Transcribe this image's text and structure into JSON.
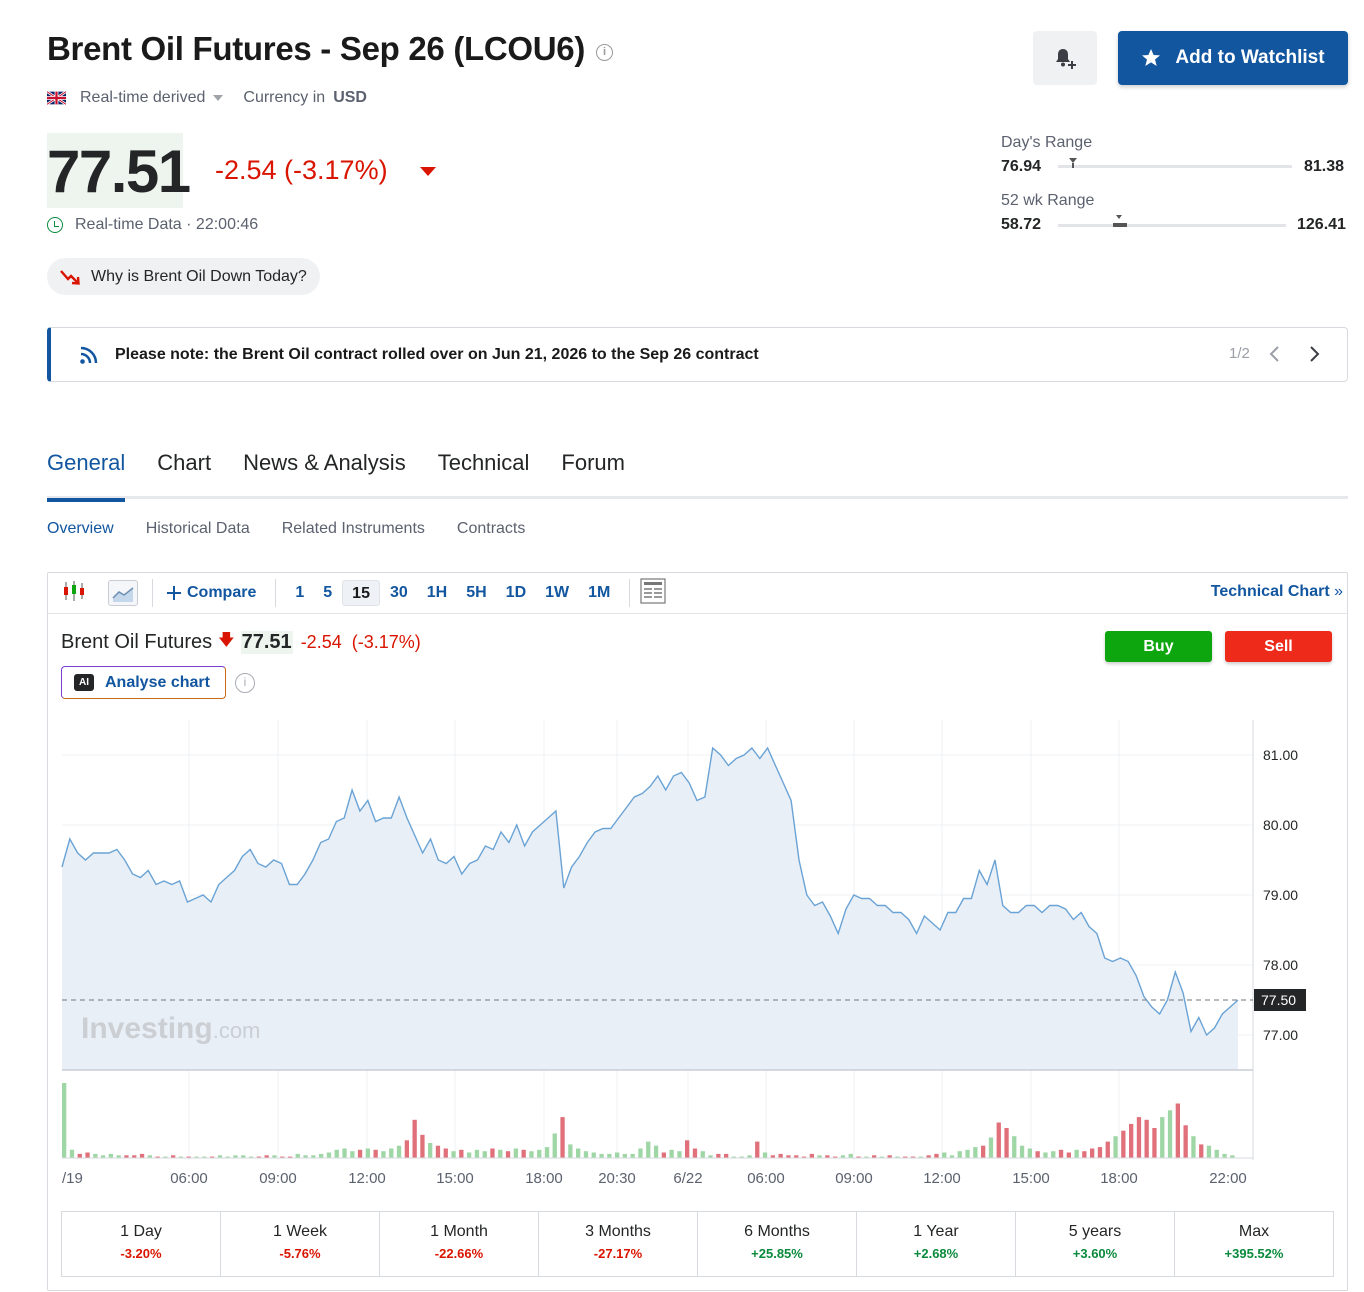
{
  "header": {
    "title": "Brent Oil Futures - Sep 26 (LCOU6)",
    "source": "Real-time derived",
    "currency_label": "Currency in",
    "currency": "USD",
    "watchlist_label": "Add to Watchlist"
  },
  "quote": {
    "price": "77.51",
    "change": "-2.54 (-3.17%)",
    "realtime_label": "Real-time Data · 22:00:46",
    "why_label": "Why is Brent Oil Down Today?"
  },
  "ranges": {
    "day_label": "Day's Range",
    "day_low": "76.94",
    "day_high": "81.38",
    "day_marker": 0.065,
    "wk52_label": "52 wk Range",
    "wk52_low": "58.72",
    "wk52_high": "126.41",
    "wk52_marker": 0.27
  },
  "notice": {
    "text": "Please note: the Brent Oil contract rolled over on Jun 21, 2026 to the Sep 26 contract",
    "page": "1/2"
  },
  "tabs": [
    "General",
    "Chart",
    "News & Analysis",
    "Technical",
    "Forum"
  ],
  "subtabs": [
    "Overview",
    "Historical Data",
    "Related Instruments",
    "Contracts"
  ],
  "toolbar": {
    "compare": "Compare",
    "intervals": [
      "1",
      "5",
      "15",
      "30",
      "1H",
      "5H",
      "1D",
      "1W",
      "1M"
    ],
    "selected": "15",
    "technical_chart": "Technical Chart"
  },
  "chart_header": {
    "name": "Brent Oil Futures",
    "price": "77.51",
    "change": "-2.54",
    "change_pct": "(-3.17%)",
    "buy": "Buy",
    "sell": "Sell",
    "ai_label": "Analyse chart",
    "ai_badge": "AI"
  },
  "watermark": {
    "brand": "Investing",
    "suffix": ".com"
  },
  "colors": {
    "accent": "#1256a0",
    "negative": "#d91400",
    "positive": "#0a8a3c",
    "line": "#6aa3d5",
    "fill": "#e9eff6"
  },
  "chart_data": {
    "type": "area",
    "ylim": [
      76.5,
      81.5
    ],
    "yticks": [
      "81.00",
      "80.00",
      "79.00",
      "78.00",
      "77.00"
    ],
    "last_price_label": "77.50",
    "last_price": 77.5,
    "xticks": [
      "/19",
      "06:00",
      "09:00",
      "12:00",
      "15:00",
      "18:00",
      "20:30",
      "6/22",
      "06:00",
      "09:00",
      "12:00",
      "15:00",
      "18:00",
      "22:00"
    ],
    "values": [
      79.4,
      79.8,
      79.6,
      79.5,
      79.6,
      79.6,
      79.6,
      79.65,
      79.5,
      79.3,
      79.25,
      79.35,
      79.15,
      79.2,
      79.15,
      79.2,
      78.9,
      78.95,
      79.0,
      78.9,
      79.15,
      79.25,
      79.35,
      79.55,
      79.65,
      79.45,
      79.4,
      79.5,
      79.45,
      79.15,
      79.15,
      79.3,
      79.5,
      79.75,
      79.8,
      80.05,
      80.1,
      80.5,
      80.2,
      80.35,
      80.05,
      80.1,
      80.1,
      80.4,
      80.1,
      79.85,
      79.6,
      79.8,
      79.5,
      79.45,
      79.55,
      79.3,
      79.45,
      79.5,
      79.7,
      79.65,
      79.9,
      79.75,
      80.0,
      79.7,
      79.9,
      80.0,
      80.1,
      80.2,
      79.1,
      79.4,
      79.55,
      79.75,
      79.9,
      79.95,
      79.95,
      80.1,
      80.25,
      80.4,
      80.45,
      80.55,
      80.7,
      80.5,
      80.7,
      80.75,
      80.6,
      80.35,
      80.4,
      81.1,
      81.0,
      80.85,
      80.95,
      81.0,
      81.1,
      80.95,
      81.1,
      80.85,
      80.6,
      80.35,
      79.5,
      79.0,
      78.85,
      78.9,
      78.7,
      78.45,
      78.8,
      79.0,
      78.95,
      78.95,
      78.85,
      78.85,
      78.75,
      78.75,
      78.65,
      78.45,
      78.7,
      78.6,
      78.5,
      78.75,
      78.75,
      78.95,
      78.95,
      79.35,
      79.15,
      79.5,
      78.85,
      78.75,
      78.75,
      78.85,
      78.85,
      78.75,
      78.85,
      78.85,
      78.8,
      78.65,
      78.75,
      78.55,
      78.45,
      78.1,
      78.05,
      78.1,
      78.05,
      77.85,
      77.55,
      77.4,
      77.3,
      77.5,
      77.9,
      77.6,
      77.05,
      77.25,
      77.0,
      77.1,
      77.3,
      77.4,
      77.5
    ],
    "volume": [
      55,
      6,
      3,
      4,
      3,
      2,
      3,
      2,
      2,
      2,
      3,
      2,
      1,
      1,
      2,
      1,
      1,
      1,
      1,
      1,
      2,
      1,
      2,
      2,
      1,
      1,
      2,
      2,
      1,
      1,
      3,
      2,
      2,
      3,
      4,
      6,
      7,
      5,
      6,
      7,
      6,
      5,
      7,
      9,
      13,
      28,
      17,
      11,
      9,
      7,
      5,
      6,
      4,
      6,
      5,
      7,
      6,
      5,
      7,
      6,
      5,
      6,
      8,
      18,
      30,
      10,
      7,
      5,
      4,
      3,
      3,
      4,
      3,
      3,
      7,
      12,
      9,
      4,
      6,
      5,
      13,
      7,
      5,
      2,
      3,
      3,
      1,
      1,
      2,
      12,
      4,
      2,
      3,
      2,
      2,
      1,
      3,
      2,
      2,
      1,
      2,
      3,
      1,
      1,
      2,
      1,
      2,
      1,
      1,
      1,
      1,
      2,
      3,
      4,
      2,
      5,
      6,
      8,
      9,
      15,
      26,
      22,
      16,
      9,
      7,
      5,
      4,
      5,
      6,
      4,
      6,
      5,
      7,
      8,
      12,
      16,
      20,
      25,
      30,
      28,
      22,
      30,
      35,
      40,
      24,
      16,
      10,
      9,
      6,
      3,
      2
    ]
  },
  "periods": [
    {
      "label": "1 Day",
      "value": "-3.20%",
      "dir": "neg"
    },
    {
      "label": "1 Week",
      "value": "-5.76%",
      "dir": "neg"
    },
    {
      "label": "1 Month",
      "value": "-22.66%",
      "dir": "neg"
    },
    {
      "label": "3 Months",
      "value": "-27.17%",
      "dir": "neg"
    },
    {
      "label": "6 Months",
      "value": "+25.85%",
      "dir": "pos"
    },
    {
      "label": "1 Year",
      "value": "+2.68%",
      "dir": "pos"
    },
    {
      "label": "5 years",
      "value": "+3.60%",
      "dir": "pos"
    },
    {
      "label": "Max",
      "value": "+395.52%",
      "dir": "pos"
    }
  ]
}
